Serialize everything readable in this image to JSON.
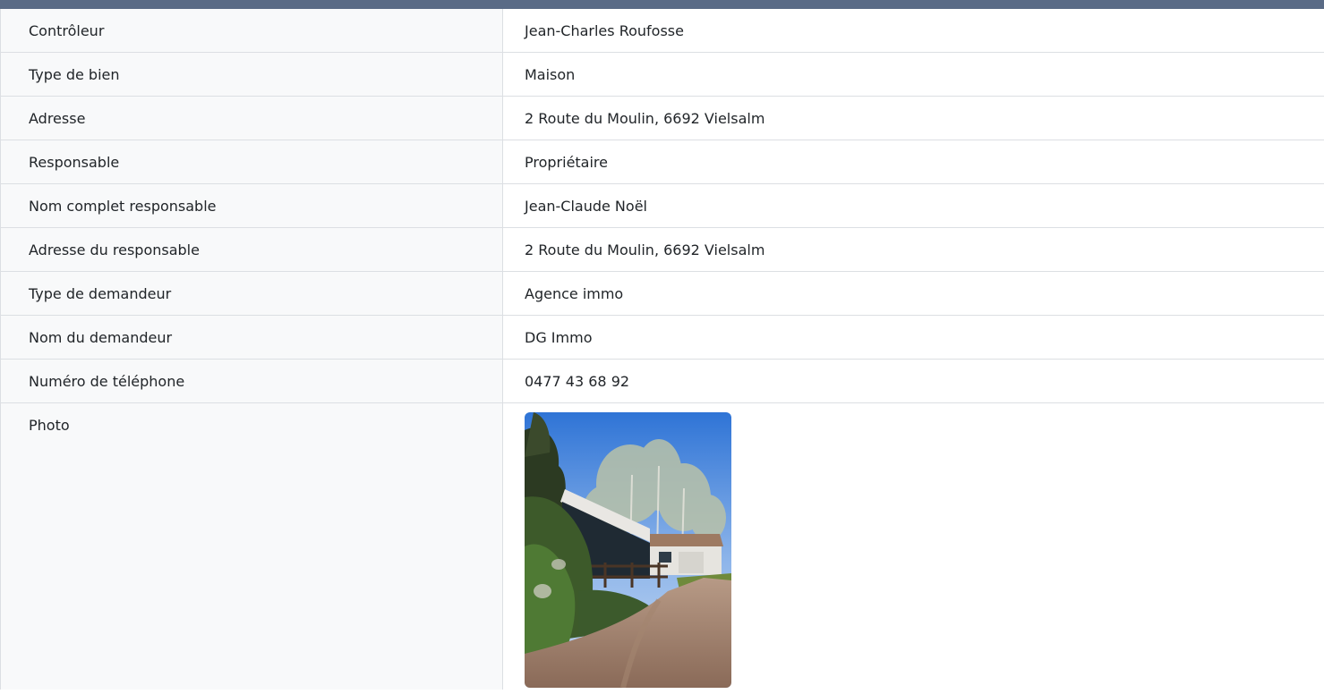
{
  "rows": [
    {
      "label": "Contrôleur",
      "value": "Jean-Charles Roufosse"
    },
    {
      "label": "Type de bien",
      "value": "Maison"
    },
    {
      "label": "Adresse",
      "value": "2 Route du Moulin, 6692 Vielsalm"
    },
    {
      "label": "Responsable",
      "value": "Propriétaire"
    },
    {
      "label": "Nom complet responsable",
      "value": "Jean-Claude Noël"
    },
    {
      "label": "Adresse du responsable",
      "value": "2 Route du Moulin, 6692 Vielsalm"
    },
    {
      "label": "Type de demandeur",
      "value": "Agence immo"
    },
    {
      "label": "Nom du demandeur",
      "value": "DG Immo"
    },
    {
      "label": "Numéro de téléphone",
      "value": "0477 43 68 92"
    }
  ],
  "photo": {
    "label": "Photo"
  },
  "colors": {
    "header": "#5a6b86",
    "label_bg": "#f8f9fa",
    "border": "#dcdfe3"
  }
}
